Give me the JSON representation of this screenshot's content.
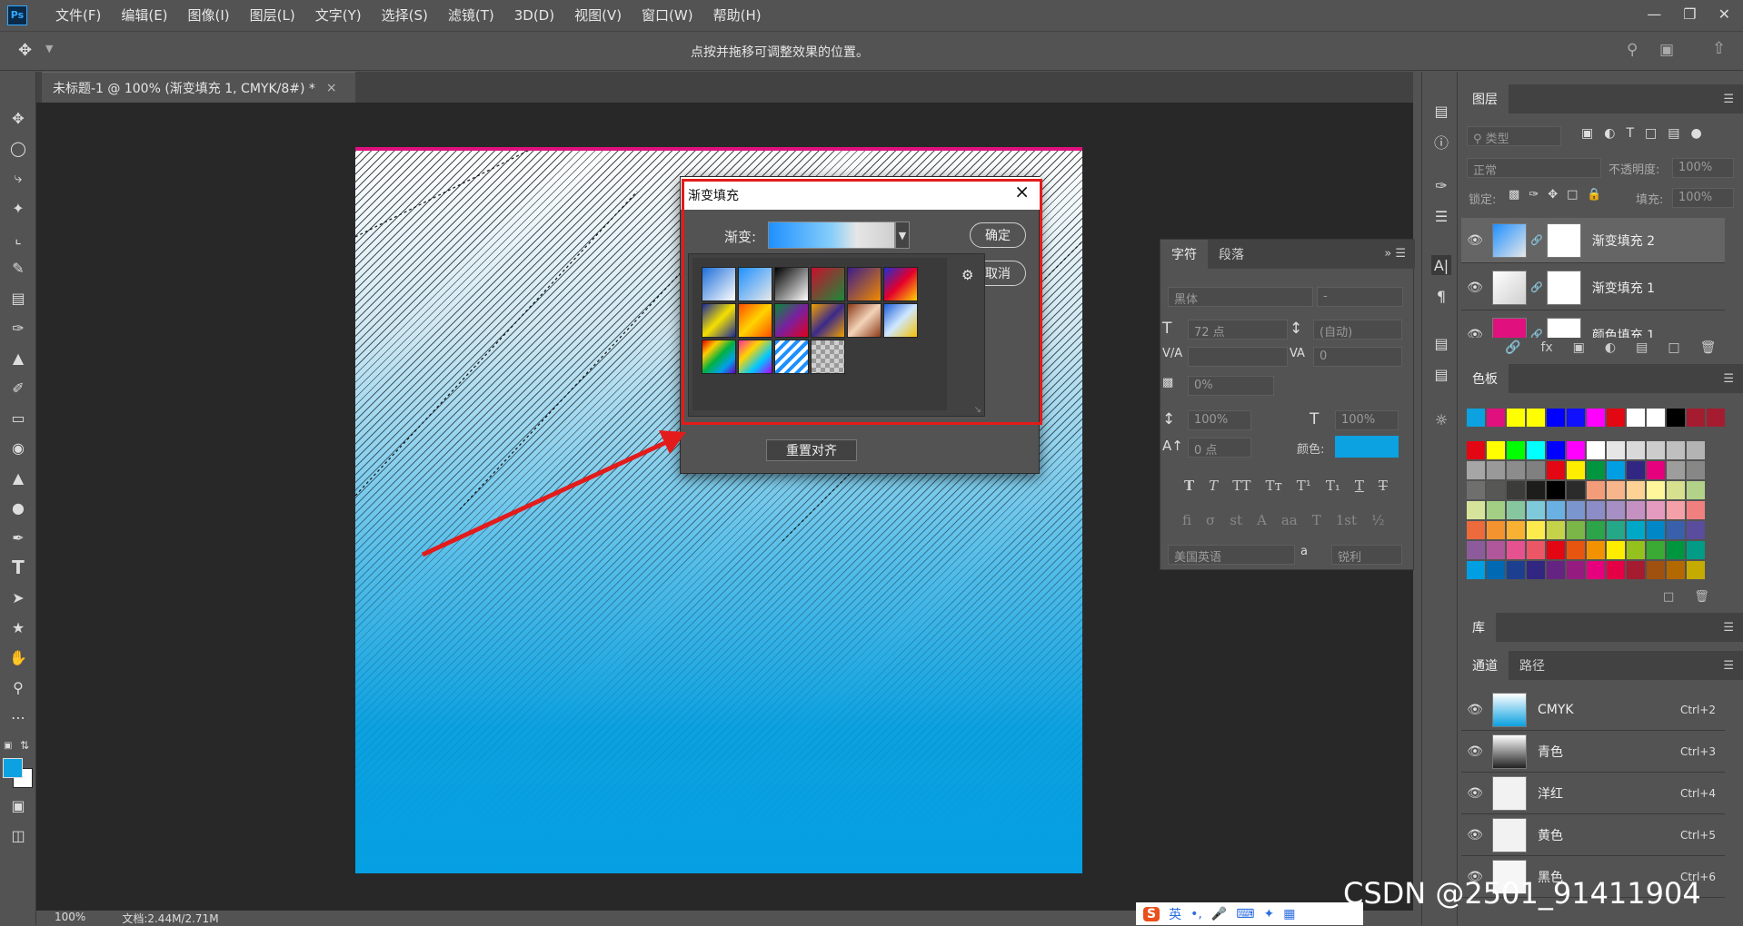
{
  "menubar": {
    "logo": "Ps",
    "items": [
      "文件(F)",
      "编辑(E)",
      "图像(I)",
      "图层(L)",
      "文字(Y)",
      "选择(S)",
      "滤镜(T)",
      "3D(D)",
      "视图(V)",
      "窗口(W)",
      "帮助(H)"
    ]
  },
  "optbar": {
    "hint": "点按并拖移可调整效果的位置。"
  },
  "document": {
    "tab_title": "未标题-1 @ 100% (渐变填充 1, CMYK/8#) *",
    "close": "×"
  },
  "statusbar": {
    "zoom": "100%",
    "doc": "文档:2.44M/2.71M"
  },
  "dialog": {
    "title": "渐变填充",
    "close": "×",
    "gradient_label": "渐变:",
    "ok": "确定",
    "cancel": "取消",
    "reset": "重置对齐",
    "presets": [
      "linear-gradient(135deg,#1e6fd9,#fff)",
      "linear-gradient(135deg,#1e90ff,#e8e8e8)",
      "linear-gradient(135deg,#000,#fff)",
      "linear-gradient(135deg,#c8102e,#1b8a3a)",
      "linear-gradient(135deg,#3b1d8a,#f08a00)",
      "linear-gradient(135deg,#1f2fd0,#e4002b,#ffd400)",
      "linear-gradient(135deg,#1a2a9a,#f5e000,#1a2a9a)",
      "linear-gradient(135deg,#ff4e00,#ffd400,#ff4e00)",
      "linear-gradient(135deg,#0a8a3a,#7a1fa0,#e2001a)",
      "linear-gradient(135deg,#f0a000,#3b2a8a,#f0a000)",
      "linear-gradient(135deg,#8a3a1a,#f3d3b8,#8a3a1a)",
      "linear-gradient(135deg,#1e5fd9,#cfe8ff,#f5c000)",
      "linear-gradient(135deg,#e10000,#ffcc00,#00b140,#00a0e9,#6a00c8)",
      "linear-gradient(135deg,#ff2d9b,#ffd400,#00c8ff,#b000ff)",
      "repeating-linear-gradient(135deg,#1e90ff 0 4px,#ffffff 4px 8px)",
      "repeating-conic-gradient(#cfcfcf 0 25%,#9a9a9a 0 50%) 0 0/10px 10px"
    ],
    "gear": "⚙"
  },
  "char_panel": {
    "tab_char": "字符",
    "tab_para": "段落",
    "font_family": "黑体",
    "font_style": "-",
    "size": "72 点",
    "leading": "(自动)",
    "kerning": "",
    "tracking": "0",
    "scale_tracking": "0%",
    "vscale": "100%",
    "hscale": "100%",
    "baseline": "0 点",
    "color_label": "颜色:",
    "language": "美国英语",
    "aa_label": "a",
    "antialias": "锐利",
    "color": "#0ca1e0"
  },
  "layers_panel": {
    "title": "图层",
    "kind": "类型",
    "blend": "正常",
    "opacity_label": "不透明度:",
    "opacity": "100%",
    "lock_label": "锁定:",
    "fill_label": "填充:",
    "fill": "100%",
    "layers": [
      {
        "name": "渐变填充 2",
        "thumb": "linear-gradient(135deg,#1e90ff,#e8e8e8)"
      },
      {
        "name": "渐变填充 1",
        "thumb": "linear-gradient(135deg,#fff,#cfcfcf)"
      },
      {
        "name": "颜色填充 1",
        "thumb": "#e0117e"
      }
    ]
  },
  "swatches_panel": {
    "title": "色板",
    "recent": [
      "#0ca1e0",
      "#e0117e",
      "#ffff00",
      "#ffff00",
      "#0000ff",
      "#1010ff",
      "#ff00ff",
      "#e30613",
      "#ffffff",
      "#ffffff",
      "#000000",
      "#a51c30",
      "#a51c30"
    ],
    "grid": [
      "#e30613",
      "#ffff00",
      "#00ff00",
      "#00ffff",
      "#0000ff",
      "#ff00ff",
      "#ffffff",
      "#e6e6e6",
      "#d9d9d9",
      "#cccccc",
      "#bfbfbf",
      "#b3b3b3",
      "#a6a6a6",
      "#999999",
      "#8c8c8c",
      "#808080",
      "#e30613",
      "#ffed00",
      "#009640",
      "#009fe3",
      "#312783",
      "#e6007e",
      "#9d9d9c",
      "#878787",
      "#6f6f6e",
      "#575756",
      "#3c3c3b",
      "#1d1d1b",
      "#000000",
      "#2b2b2b",
      "#f39c7a",
      "#f7b58c",
      "#fcd295",
      "#fff59b",
      "#d7e08e",
      "#b2d28a",
      "#d5e49a",
      "#a3cf85",
      "#87c7a0",
      "#7ecadb",
      "#6ab0e3",
      "#7b96cf",
      "#8c8cc7",
      "#a58fc4",
      "#c591c3",
      "#e59ac0",
      "#f4a0a9",
      "#f08080",
      "#ec6a3c",
      "#f39330",
      "#f8b133",
      "#fdeb4e",
      "#c5d34b",
      "#7ab648",
      "#2ba44a",
      "#25a887",
      "#00a8c8",
      "#0087c8",
      "#3860ab",
      "#5b4d9d",
      "#8c5b9c",
      "#b0579c",
      "#e5528f",
      "#ec5766",
      "#e30613",
      "#e8550f",
      "#f39200",
      "#ffed00",
      "#95c11f",
      "#3aaa35",
      "#009640",
      "#009c85",
      "#009fe3",
      "#0069b4",
      "#1d3f8f",
      "#312783",
      "#662482",
      "#951b81",
      "#e6007e",
      "#e50046",
      "#a51c30",
      "#a0500f",
      "#b36800",
      "#c5aa00"
    ]
  },
  "libraries_panel": {
    "title": "库"
  },
  "channels_panel": {
    "tab_channels": "通道",
    "tab_paths": "路径",
    "channels": [
      {
        "name": "CMYK",
        "shortcut": "Ctrl+2",
        "thumb": "linear-gradient(#fff,#0ca1e0)"
      },
      {
        "name": "青色",
        "shortcut": "Ctrl+3",
        "thumb": "linear-gradient(#fff,#222)"
      },
      {
        "name": "洋红",
        "shortcut": "Ctrl+4",
        "thumb": "#f2f2f2"
      },
      {
        "name": "黄色",
        "shortcut": "Ctrl+5",
        "thumb": "#f2f2f2"
      },
      {
        "name": "黑色",
        "shortcut": "Ctrl+6",
        "thumb": "#f6f6f6"
      }
    ]
  },
  "watermark": "CSDN @2501_91411904",
  "ime": {
    "label": "英"
  }
}
